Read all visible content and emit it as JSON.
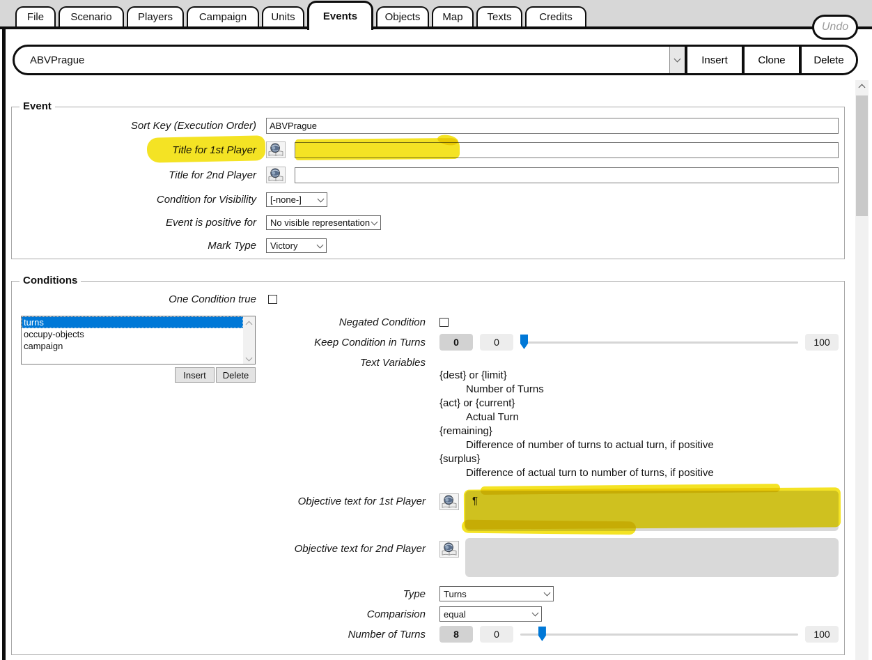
{
  "tabs": [
    "File",
    "Scenario",
    "Players",
    "Campaign",
    "Units",
    "Events",
    "Objects",
    "Map",
    "Texts",
    "Credits"
  ],
  "active_tab": "Events",
  "undo_label": "Undo",
  "selector": {
    "value": "ABVPrague",
    "insert": "Insert",
    "clone": "Clone",
    "delete": "Delete"
  },
  "event": {
    "legend": "Event",
    "sort_key": {
      "label": "Sort Key (Execution Order)",
      "value": "ABVPrague"
    },
    "title_1st": {
      "label": "Title for 1st Player",
      "value": ""
    },
    "title_2nd": {
      "label": "Title for 2nd Player",
      "value": ""
    },
    "visibility": {
      "label": "Condition for Visibility",
      "value": "[-none-]"
    },
    "positive_for": {
      "label": "Event is positive for",
      "value": "No visible representation"
    },
    "mark_type": {
      "label": "Mark Type",
      "value": "Victory"
    }
  },
  "conditions": {
    "legend": "Conditions",
    "one_condition_label": "One Condition true",
    "items": [
      "turns",
      "occupy-objects",
      "campaign"
    ],
    "selected_item": "turns",
    "insert": "Insert",
    "delete": "Delete",
    "negated_label": "Negated Condition",
    "keep": {
      "label": "Keep Condition in Turns",
      "value": "0",
      "value2": "0",
      "max": "100"
    },
    "text_variables_label": "Text Variables",
    "variables": [
      {
        "token": "{dest} or {limit}",
        "desc": "Number of Turns"
      },
      {
        "token": "{act} or {current}",
        "desc": "Actual Turn"
      },
      {
        "token": "{remaining}",
        "desc": "Difference of number of turns to actual turn, if positive"
      },
      {
        "token": "{surplus}",
        "desc": "Difference of actual turn to number of turns, if positive"
      }
    ],
    "objective_1st": {
      "label": "Objective text for 1st Player",
      "value": "¶"
    },
    "objective_2nd": {
      "label": "Objective text for 2nd Player",
      "value": ""
    },
    "type": {
      "label": "Type",
      "value": "Turns"
    },
    "comparision": {
      "label": "Comparision",
      "value": "equal"
    },
    "number_of_turns": {
      "label": "Number of Turns",
      "value": "8",
      "value2": "0",
      "max": "100"
    }
  },
  "colors": {
    "highlight": "#f3e111",
    "selection_blue": "#0078d7",
    "slider_thumb": "#0078d7",
    "tabbar_gray": "#d7d7d7"
  }
}
